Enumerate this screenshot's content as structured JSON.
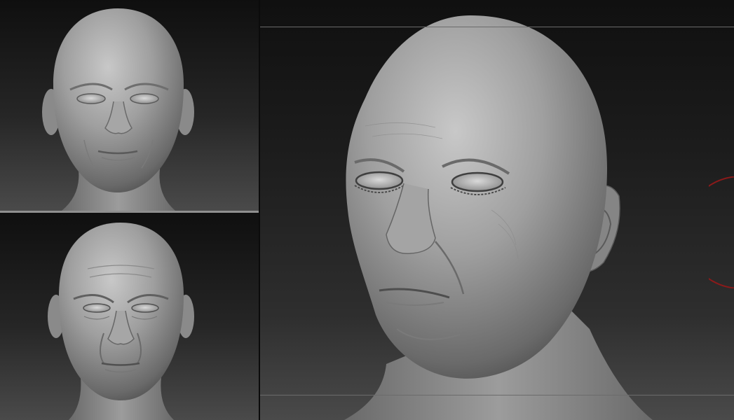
{
  "viewports": [
    {
      "name": "front-view-smooth",
      "sculpt_level": "low-detail"
    },
    {
      "name": "front-view-aged",
      "sculpt_level": "mid-detail"
    },
    {
      "name": "three-quarter-view-detailed",
      "sculpt_level": "high-detail"
    }
  ],
  "colors": {
    "clay": "#9a9a9a",
    "background_top": "#0f0f0f",
    "background_bottom": "#4a4a4a",
    "divider": "#8f8f8f",
    "gizmo_ring": "#8b1a1a"
  },
  "icons": [
    "rotation-gizmo-icon"
  ]
}
